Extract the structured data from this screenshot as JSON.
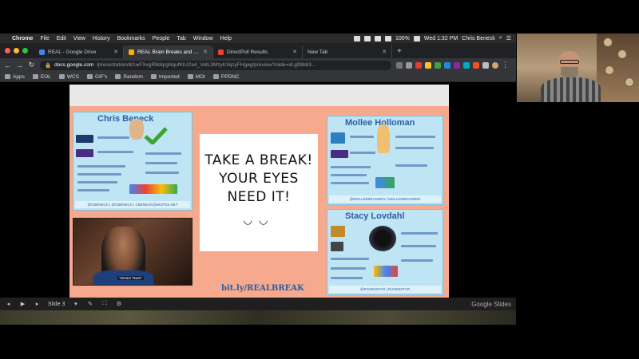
{
  "menubar": {
    "app": "Chrome",
    "items": [
      "File",
      "Edit",
      "View",
      "History",
      "Bookmarks",
      "People",
      "Tab",
      "Window",
      "Help"
    ],
    "battery": "100%",
    "clock": "Wed 1:32 PM",
    "user": "Chris Beneck"
  },
  "tabs": [
    {
      "label": "REAL - Google Drive",
      "color": "#4285f4"
    },
    {
      "label": "REAL Brain Breaks and Off Sc...",
      "color": "#f4b400"
    },
    {
      "label": "DirectPoll Results",
      "color": "#ea4335"
    },
    {
      "label": "New Tab",
      "color": "#5f6368"
    }
  ],
  "address": {
    "domain": "docs.google.com",
    "path": "/presentation/d/1wFXxgR8dqrgNqufKhJ2a4_VetL2MzyK3qcyFHgag/preview?slide=id.g99bb3..."
  },
  "bookmarks": [
    "Apps",
    "EOL",
    "WCS",
    "GIF's",
    "Random",
    "Imported",
    "MOI",
    "PPDNC"
  ],
  "slide": {
    "card_left_name": "Chris     Beneck",
    "card_right_top_name": "Mollee     Holloman",
    "card_right_bottom_name": "Stacy     Lovdahl",
    "card_left_footer": "@CBENECK  |  @CBENECK  |  CBENECK@WCPSS.NET",
    "card_right_top_footer": "@MOLLEEBRANDEN  |  MOLLEEBRANDEN",
    "card_right_bottom_footer": "@RAVENSTAR  |  RAVENSTAR",
    "center_line1": "TAKE A BREAK!",
    "center_line2": "YOUR EYES",
    "center_line3": "NEED IT!",
    "eyes": "◡◡",
    "photo_caption": "\"Dream Team\"",
    "link": "bit.ly/REALBREAK"
  },
  "controls": {
    "slide_label": "Slide 3",
    "brand": "Google Slides"
  }
}
